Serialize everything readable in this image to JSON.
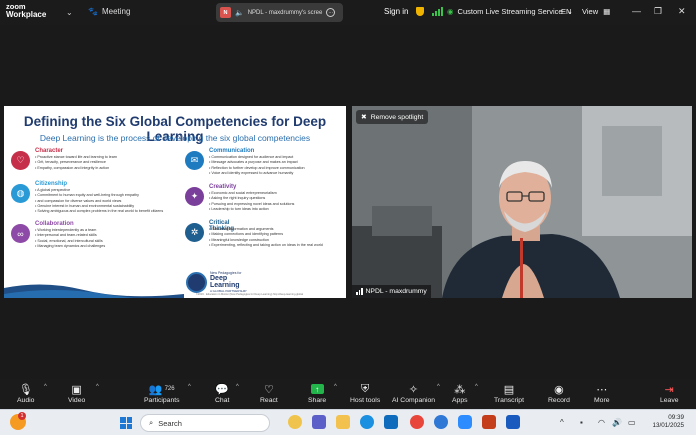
{
  "titlebar": {
    "app_line1": "zoom",
    "app_line2": "Workplace",
    "meeting_label": "Meeting",
    "share_badge": "N",
    "share_title": "NPDL - maxdrummy's scree",
    "sign_in": "Sign in",
    "live_streaming": "Custom Live Streaming Service",
    "language": "EN",
    "view": "View"
  },
  "slide": {
    "title": "Defining the Six Global Competencies for Deep Learning",
    "subtitle": "Deep Learning is the process of developing the six global competencies",
    "competencies": [
      {
        "name": "Character",
        "color": "#c62f4a",
        "icon": "heart-icon",
        "bullets": [
          "Proactive stance toward life and learning to learn",
          "Grit, tenacity, perseverance and resilience",
          "Empathy, compassion and integrity in action"
        ]
      },
      {
        "name": "Citizenship",
        "color": "#2a9ad6",
        "icon": "globe-icon",
        "bullets": [
          "A global perspective",
          "Commitment to human equity and well-being through empathy",
          "and compassion for diverse values and world views",
          "Genuine interest in human and environmental sustainability",
          "Solving ambiguous and complex problems in the real world to benefit citizens"
        ]
      },
      {
        "name": "Collaboration",
        "color": "#8d4aa6",
        "icon": "links-icon",
        "bullets": [
          "Working interdependently as a team",
          "Interpersonal and team-related skills",
          "Social, emotional, and intercultural skills",
          "Managing team dynamics and challenges"
        ]
      },
      {
        "name": "Communication",
        "color": "#1f7bc0",
        "icon": "chat-icon",
        "bullets": [
          "Communication designed for audience and impact",
          "Message advocates a purpose and makes an impact",
          "Reflection to further develop and improve communication",
          "Voice and identity expressed to advance humanity"
        ]
      },
      {
        "name": "Creativity",
        "color": "#7a3f9a",
        "icon": "bulb-icon",
        "bullets": [
          "Economic and social entrepreneurialism",
          "Asking the right inquiry questions",
          "Pursuing and expressing novel ideas and solutions",
          "Leadership to turn ideas into action"
        ]
      },
      {
        "name": "Critical Thinking",
        "color": "#1e5f8f",
        "icon": "network-icon",
        "bullets": [
          "Evaluating information and arguments",
          "Making connections and identifying patterns",
          "Meaningful knowledge construction",
          "Experimenting, reflecting and taking action on ideas in the real world"
        ]
      }
    ],
    "logo_line1": "New Pedagogies for",
    "logo_line2a": "Deep",
    "logo_line2b": "Learning",
    "logo_line3": "A GLOBAL PARTNERSHIP",
    "footer": "©2019 · Education in Motion (New Pedagogies for Deep Learning) http://deep-learning.global"
  },
  "video": {
    "remove_spotlight": "Remove spotlight",
    "participant_name": "NPDL - maxdrummy"
  },
  "toolbar": {
    "audio": "Audio",
    "video": "Video",
    "participants": "Participants",
    "participants_count": "726",
    "chat": "Chat",
    "react": "React",
    "share": "Share",
    "host_tools": "Host tools",
    "ai_companion": "AI Companion",
    "apps": "Apps",
    "transcript": "Transcript",
    "record": "Record",
    "more": "More",
    "leave": "Leave"
  },
  "taskbar": {
    "weather_badge": "1",
    "search_placeholder": "Search",
    "time": "09:39",
    "date": "13/01/2025"
  }
}
